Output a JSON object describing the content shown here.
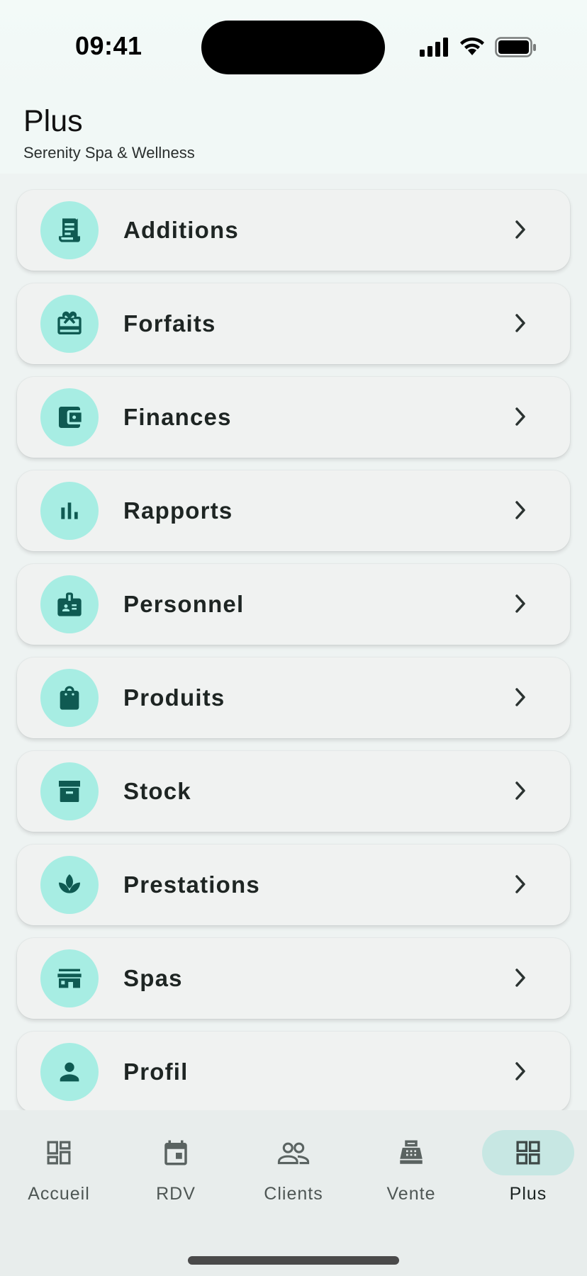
{
  "status_bar": {
    "time": "09:41"
  },
  "header": {
    "title": "Plus",
    "subtitle": "Serenity Spa & Wellness"
  },
  "menu": [
    {
      "label": "Additions",
      "icon": "receipt-icon"
    },
    {
      "label": "Forfaits",
      "icon": "gift-card-icon"
    },
    {
      "label": "Finances",
      "icon": "wallet-icon"
    },
    {
      "label": "Rapports",
      "icon": "bar-chart-icon"
    },
    {
      "label": "Personnel",
      "icon": "badge-icon"
    },
    {
      "label": "Produits",
      "icon": "shopping-bag-icon"
    },
    {
      "label": "Stock",
      "icon": "archive-icon"
    },
    {
      "label": "Prestations",
      "icon": "lotus-icon"
    },
    {
      "label": "Spas",
      "icon": "storefront-icon"
    },
    {
      "label": "Profil",
      "icon": "person-icon"
    }
  ],
  "bottom_nav": [
    {
      "label": "Accueil",
      "icon": "dashboard-icon",
      "active": false
    },
    {
      "label": "RDV",
      "icon": "calendar-icon",
      "active": false
    },
    {
      "label": "Clients",
      "icon": "people-icon",
      "active": false
    },
    {
      "label": "Vente",
      "icon": "cash-register-icon",
      "active": false
    },
    {
      "label": "Plus",
      "icon": "grid-icon",
      "active": true
    }
  ],
  "colors": {
    "accent_circle": "#a7ede3",
    "icon_dark": "#0f5a52",
    "active_nav_pill": "#c7e7e3"
  }
}
